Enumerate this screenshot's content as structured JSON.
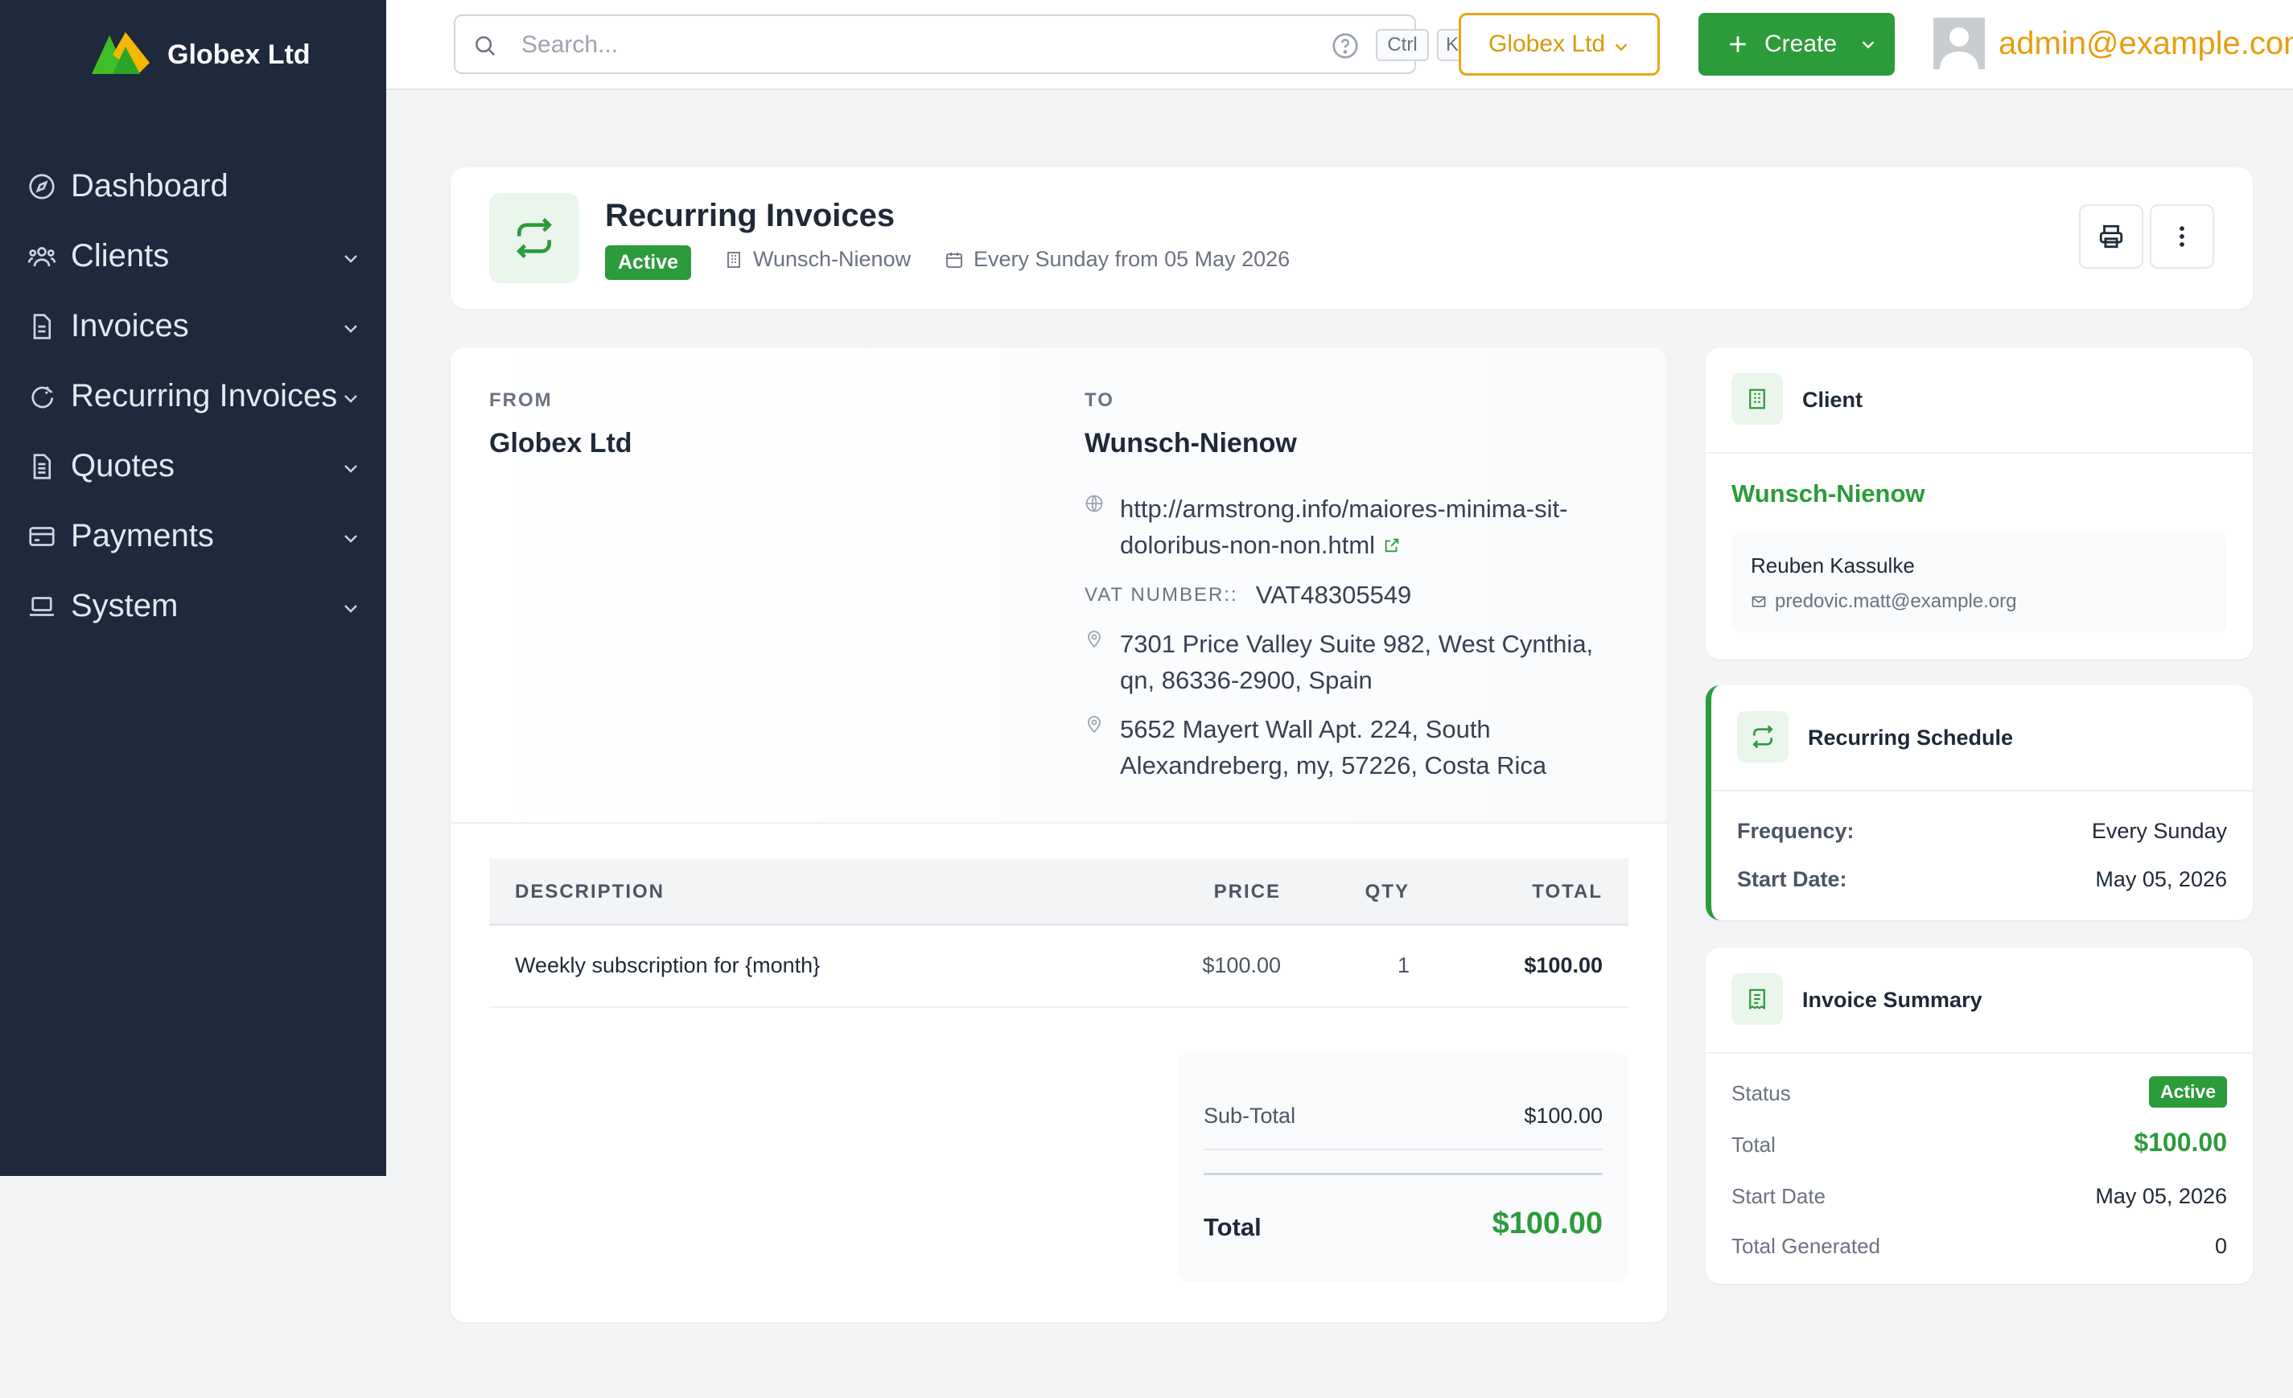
{
  "brand": {
    "name": "Globex Ltd"
  },
  "sidebar": {
    "items": [
      {
        "label": "Dashboard",
        "icon": "dashboard-icon"
      },
      {
        "label": "Clients",
        "icon": "users-icon"
      },
      {
        "label": "Invoices",
        "icon": "file-icon"
      },
      {
        "label": "Recurring Invoices",
        "icon": "recurring-icon"
      },
      {
        "label": "Quotes",
        "icon": "file-text-icon"
      },
      {
        "label": "Payments",
        "icon": "credit-card-icon"
      },
      {
        "label": "System",
        "icon": "laptop-icon"
      }
    ]
  },
  "topbar": {
    "search_placeholder": "Search...",
    "kbd_ctrl": "Ctrl",
    "kbd_k": "K",
    "org_label": "Globex Ltd",
    "create_label": "Create",
    "user_email": "admin@example.com"
  },
  "header": {
    "title": "Recurring Invoices",
    "status": "Active",
    "client": "Wunsch-Nienow",
    "schedule": "Every Sunday from 05 May 2026"
  },
  "invoice": {
    "from_label": "FROM",
    "from_name": "Globex Ltd",
    "to_label": "TO",
    "to_name": "Wunsch-Nienow",
    "website_line1": "http://armstrong.info/maiores-minima-sit-",
    "website_line2": "doloribus-non-non.html",
    "vat_label": "VAT NUMBER::",
    "vat_value": "VAT48305549",
    "address1_line1": "7301 Price Valley Suite 982, West Cynthia,",
    "address1_line2": "qn, 86336-2900, Spain",
    "address2_line1": "5652 Mayert Wall Apt. 224, South",
    "address2_line2": "Alexandreberg, my, 57226, Costa Rica",
    "columns": {
      "description": "DESCRIPTION",
      "price": "PRICE",
      "qty": "QTY",
      "total": "TOTAL"
    },
    "items": [
      {
        "description": "Weekly subscription for {month}",
        "price": "$100.00",
        "qty": "1",
        "total": "$100.00"
      }
    ],
    "subtotal_label": "Sub-Total",
    "subtotal_value": "$100.00",
    "total_label": "Total",
    "total_value": "$100.00"
  },
  "client_card": {
    "title": "Client",
    "name": "Wunsch-Nienow",
    "contact_name": "Reuben Kassulke",
    "contact_email": "predovic.matt@example.org"
  },
  "schedule_card": {
    "title": "Recurring Schedule",
    "frequency_label": "Frequency:",
    "frequency_value": "Every Sunday",
    "start_label": "Start Date:",
    "start_value": "May 05, 2026"
  },
  "summary_card": {
    "title": "Invoice Summary",
    "status_label": "Status",
    "status_value": "Active",
    "total_label": "Total",
    "total_value": "$100.00",
    "start_label": "Start Date",
    "start_value": "May 05, 2026",
    "generated_label": "Total Generated",
    "generated_value": "0"
  },
  "colors": {
    "sidebar_bg": "#1e293b",
    "accent_green": "#2c9b3a",
    "accent_orange": "#e69d0f",
    "page_bg": "#f3f4f6"
  }
}
